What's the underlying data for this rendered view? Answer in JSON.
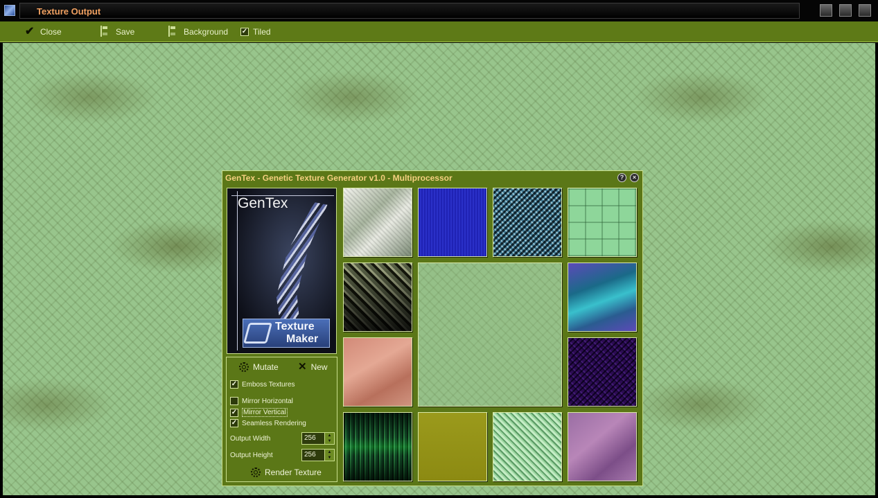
{
  "window": {
    "title": "Texture Output"
  },
  "toolbar": {
    "close_label": "Close",
    "save_label": "Save",
    "background_label": "Background",
    "tiled_label": "Tiled",
    "tiled_checked": true
  },
  "dialog": {
    "title": "GenTex - Genetic Texture Generator v1.0 - Multiprocessor",
    "help_icon": "help-icon",
    "close_icon": "close-icon",
    "logo": {
      "title": "GenTex",
      "brand_line1": "Texture",
      "brand_line2": "Maker"
    },
    "controls": {
      "mutate_label": "Mutate",
      "new_label": "New",
      "emboss_label": "Emboss Textures",
      "emboss_checked": true,
      "mirror_h_label": "Mirror Horizontal",
      "mirror_h_checked": false,
      "mirror_v_label": "Mirror Vertical",
      "mirror_v_checked": true,
      "seamless_label": "Seamless Rendering",
      "seamless_checked": true,
      "width_label": "Output Width",
      "width_value": "256",
      "height_label": "Output Height",
      "height_value": "256",
      "render_label": "Render Texture"
    }
  },
  "colors": {
    "toolbar_bg": "#5e7a17",
    "title_text": "#f0a060",
    "dialog_title": "#f5d080",
    "texture_base": "#98c58c"
  }
}
